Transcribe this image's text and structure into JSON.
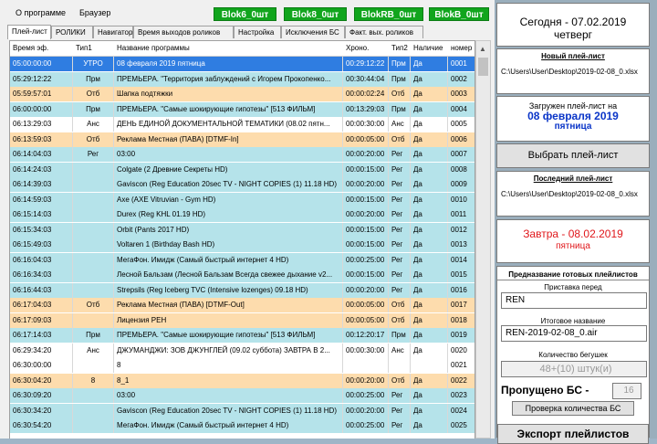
{
  "menu": {
    "about": "О программе",
    "browser": "Браузер"
  },
  "bloks": [
    {
      "label": "Blok6_0шт"
    },
    {
      "label": "Blok8_0шт"
    },
    {
      "label": "BlokRB_0шт"
    },
    {
      "label": "BlokB_0шт"
    }
  ],
  "tabs": [
    "Плей-лист",
    "РОЛИКИ",
    "Навигатор",
    "Время выходов роликов",
    "Настройка",
    "Исключения БС",
    "Факт. вых. роликов"
  ],
  "columns": [
    "Время эф.",
    "Тип1",
    "Название программы",
    "Хроно.",
    "Тип2",
    "Наличие",
    "номер"
  ],
  "rows": [
    {
      "style": "sel",
      "cells": [
        "05:00:00:00",
        "УТРО",
        "08 февраля 2019  пятница",
        "00:29:12:22",
        "Прм",
        "Да",
        "0001"
      ]
    },
    {
      "style": "cyan",
      "cells": [
        "05:29:12:22",
        "Прм",
        "ПРЕМЬЕРА. \"Территория заблуждений с Игорем Прокопенко...",
        "00:30:44:04",
        "Прм",
        "Да",
        "0002"
      ]
    },
    {
      "style": "orange",
      "cells": [
        "05:59:57:01",
        "Отб",
        "Шапка подтяжки",
        "00:00:02:24",
        "Отб",
        "Да",
        "0003"
      ]
    },
    {
      "style": "cyan",
      "cells": [
        "06:00:00:00",
        "Прм",
        "ПРЕМЬЕРА. \"Самые шокирующие гипотезы\" [513 ФИЛЬМ]",
        "00:13:29:03",
        "Прм",
        "Да",
        "0004"
      ]
    },
    {
      "style": "white",
      "cells": [
        "06:13:29:03",
        "Анс",
        "ДЕНЬ ЕДИНОЙ ДОКУМЕНТАЛЬНОЙ ТЕМАТИКИ (08.02 пятн...",
        "00:00:30:00",
        "Анс",
        "Да",
        "0005"
      ]
    },
    {
      "style": "orange",
      "cells": [
        "06:13:59:03",
        "Отб",
        "Реклама Местная (ПАВА) [DTMF-In]",
        "00:00:05:00",
        "Отб",
        "Да",
        "0006"
      ]
    },
    {
      "style": "cyan",
      "cells": [
        "06:14:04:03",
        "Рег",
        "03:00",
        "00:00:20:00",
        "Рег",
        "Да",
        "0007"
      ]
    },
    {
      "style": "cyan",
      "cells": [
        "06:14:24:03",
        "",
        "Colgate (2 Древние Секреты HD)",
        "00:00:15:00",
        "Рег",
        "Да",
        "0008"
      ]
    },
    {
      "style": "cyan",
      "cells": [
        "06:14:39:03",
        "",
        "Gaviscon (Reg Education 20sec TV - NIGHT COPIES (1) 11.18 HD)",
        "00:00:20:00",
        "Рег",
        "Да",
        "0009"
      ]
    },
    {
      "style": "cyan",
      "cells": [
        "06:14:59:03",
        "",
        "Axe (AXE Vitruvian - Gym HD)",
        "00:00:15:00",
        "Рег",
        "Да",
        "0010"
      ]
    },
    {
      "style": "cyan",
      "cells": [
        "06:15:14:03",
        "",
        "Durex (Reg KHL 01.19 HD)",
        "00:00:20:00",
        "Рег",
        "Да",
        "0011"
      ]
    },
    {
      "style": "cyan",
      "cells": [
        "06:15:34:03",
        "",
        "Orbit (Pants 2017 HD)",
        "00:00:15:00",
        "Рег",
        "Да",
        "0012"
      ]
    },
    {
      "style": "cyan",
      "cells": [
        "06:15:49:03",
        "",
        "Voltaren 1 (Birthday Bash HD)",
        "00:00:15:00",
        "Рег",
        "Да",
        "0013"
      ]
    },
    {
      "style": "cyan",
      "cells": [
        "06:16:04:03",
        "",
        "МегаФон. Имидж (Самый быстрый интернет 4 HD)",
        "00:00:25:00",
        "Рег",
        "Да",
        "0014"
      ]
    },
    {
      "style": "cyan",
      "cells": [
        "06:16:34:03",
        "",
        "Лесной Бальзам (Лесной Бальзам Всегда свежее дыхание v2...",
        "00:00:15:00",
        "Рег",
        "Да",
        "0015"
      ]
    },
    {
      "style": "cyan",
      "cells": [
        "06:16:44:03",
        "",
        "Strepsils (Reg Iceberg TVC (Intensive lozenges) 09.18 HD)",
        "00:00:20:00",
        "Рег",
        "Да",
        "0016"
      ]
    },
    {
      "style": "orange",
      "cells": [
        "06:17:04:03",
        "Отб",
        "Реклама Местная (ПАВА) [DTMF-Out]",
        "00:00:05:00",
        "Отб",
        "Да",
        "0017"
      ]
    },
    {
      "style": "orange",
      "cells": [
        "06:17:09:03",
        "",
        "Лицензия РЕН",
        "00:00:05:00",
        "Отб",
        "Да",
        "0018"
      ]
    },
    {
      "style": "cyan",
      "cells": [
        "06:17:14:03",
        "Прм",
        "ПРЕМЬЕРА. \"Самые шокирующие гипотезы\" [513 ФИЛЬМ]",
        "00:12:20:17",
        "Прм",
        "Да",
        "0019"
      ]
    },
    {
      "style": "white",
      "cells": [
        "06:29:34:20",
        "Анс",
        "ДЖУМАНДЖИ: ЗОВ ДЖУНГЛЕЙ (09.02 суббота) ЗАВТРА В 2...",
        "00:00:30:00",
        "Анс",
        "Да",
        "0020"
      ]
    },
    {
      "style": "white",
      "cells": [
        "06:30:00:00",
        "",
        "8",
        "",
        "",
        "",
        "0021"
      ]
    },
    {
      "style": "orange",
      "cells": [
        "06:30:04:20",
        "8",
        "8_1",
        "00:00:20:00",
        "Отб",
        "Да",
        "0022"
      ]
    },
    {
      "style": "cyan",
      "cells": [
        "06:30:09:20",
        "",
        "03:00",
        "00:00:25:00",
        "Рег",
        "Да",
        "0023"
      ]
    },
    {
      "style": "cyan",
      "cells": [
        "06:30:34:20",
        "",
        "Gaviscon (Reg Education 20sec TV - NIGHT COPIES (1) 11.18 HD)",
        "00:00:20:00",
        "Рег",
        "Да",
        "0024"
      ]
    },
    {
      "style": "cyan",
      "cells": [
        "06:30:54:20",
        "",
        "МегаФон. Имидж (Самый быстрый интернет 4 HD)",
        "00:00:25:00",
        "Рег",
        "Да",
        "0025"
      ]
    }
  ],
  "panel": {
    "today_line1": "Сегодня - 07.02.2019",
    "today_line2": "четверг",
    "new_playlist_label": "Новый плей-лист",
    "new_playlist_path": "C:\\Users\\User\\Desktop\\2019-02-08_0.xlsx",
    "loaded_label": "Загружен плей-лист на",
    "loaded_date": "08 февраля 2019",
    "loaded_day": "пятница",
    "choose_button": "Выбрать плей-лист",
    "last_playlist_label": "Последний плей-лист",
    "last_playlist_path": "C:\\Users\\User\\Desktop\\2019-02-08_0.xlsx",
    "tomorrow_line1": "Завтра - 08.02.2019",
    "tomorrow_line2": "пятница",
    "naming_label": "Предназвание готовых плейлистов",
    "prefix_label": "Приставка перед",
    "prefix_value": "REN",
    "final_name_label": "Итоговое название",
    "final_name_value": "REN-2019-02-08_0.air",
    "ticker_label": "Количество бегушек",
    "ticker_value": "48+(10) штук(и)",
    "missed_label": "Пропущено БС -",
    "missed_value": "16",
    "check_button": "Проверка количества БС",
    "export_button": "Экспорт плейлистов"
  }
}
